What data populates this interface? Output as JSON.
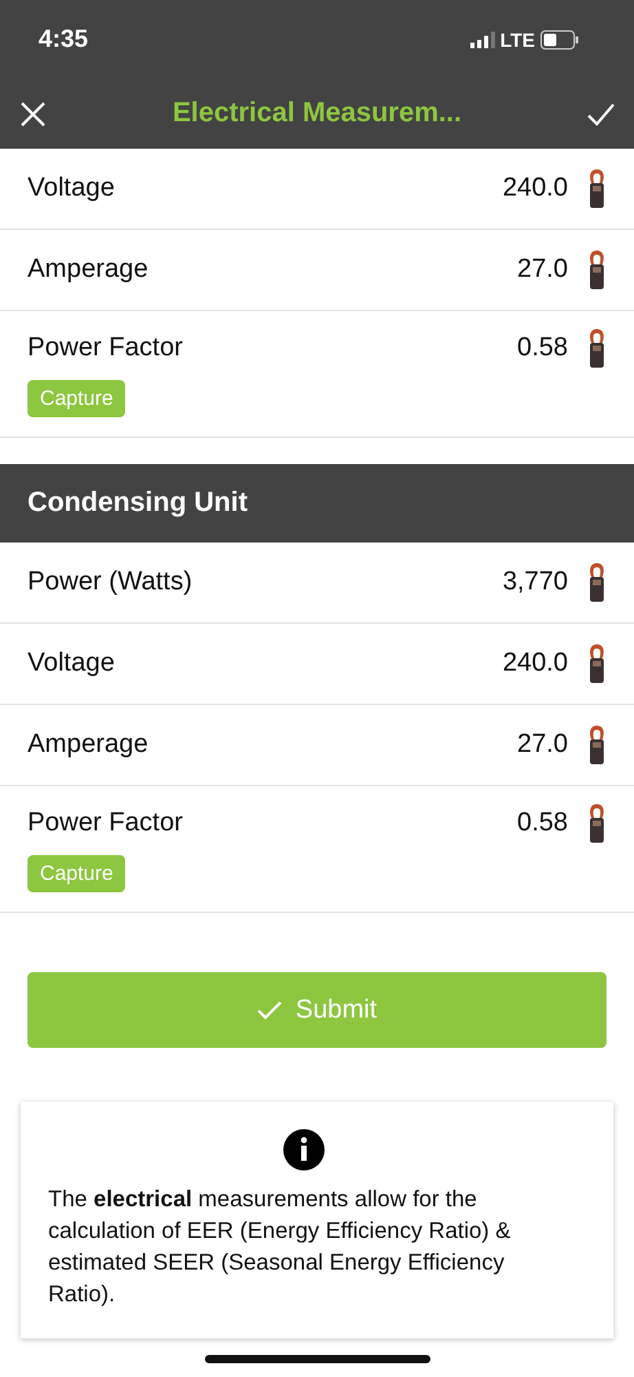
{
  "status_bar": {
    "time": "4:35",
    "network": "LTE"
  },
  "nav": {
    "title": "Electrical Measurem..."
  },
  "sections": [
    {
      "rows": [
        {
          "label": "Voltage",
          "value": "240.0"
        },
        {
          "label": "Amperage",
          "value": "27.0"
        },
        {
          "label": "Power Factor",
          "value": "0.58",
          "action": "Capture"
        }
      ]
    },
    {
      "title": "Condensing Unit",
      "rows": [
        {
          "label": "Power (Watts)",
          "value": "3,770"
        },
        {
          "label": "Voltage",
          "value": "240.0"
        },
        {
          "label": "Amperage",
          "value": "27.0"
        },
        {
          "label": "Power Factor",
          "value": "0.58",
          "action": "Capture"
        }
      ]
    }
  ],
  "submit": "Submit",
  "info": "The **electrical** measurements allow for the calculation of EER (Energy Efficiency Ratio) & estimated SEER (Seasonal Energy Efficiency Ratio)."
}
